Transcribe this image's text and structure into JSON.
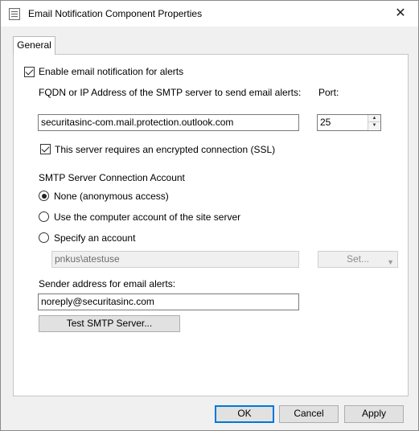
{
  "window": {
    "title": "Email Notification Component Properties",
    "close_glyph": "✕"
  },
  "tabs": [
    {
      "label": "General",
      "selected": true
    }
  ],
  "general": {
    "enable_alerts": {
      "label": "Enable email notification for alerts",
      "checked": true
    },
    "smtp_server_label": "FQDN or IP Address of the SMTP server to send email alerts:",
    "smtp_server_value": "securitasinc-com.mail.protection.outlook.com",
    "port_label": "Port:",
    "port_value": "25",
    "ssl": {
      "label": "This server requires an encrypted connection (SSL)",
      "checked": true
    },
    "account_section_label": "SMTP Server Connection Account",
    "account_options": [
      {
        "label": "None (anonymous access)",
        "selected": true
      },
      {
        "label": "Use the computer account of the site server",
        "selected": false
      },
      {
        "label": "Specify an account",
        "selected": false
      }
    ],
    "account_value": "pnkus\\atestuse",
    "set_button_label": "Set...",
    "sender_label": "Sender address for email alerts:",
    "sender_value": "noreply@securitasinc.com",
    "test_button_label": "Test SMTP Server..."
  },
  "footer": {
    "ok_label": "OK",
    "cancel_label": "Cancel",
    "apply_label": "Apply"
  },
  "colors": {
    "accent": "#0078d7",
    "dialog_bg": "#f0f0f0",
    "panel_bg": "#ffffff"
  },
  "icons": {
    "title": "properties-document-icon",
    "close": "close-icon",
    "set_dropdown": "chevron-down-icon"
  }
}
